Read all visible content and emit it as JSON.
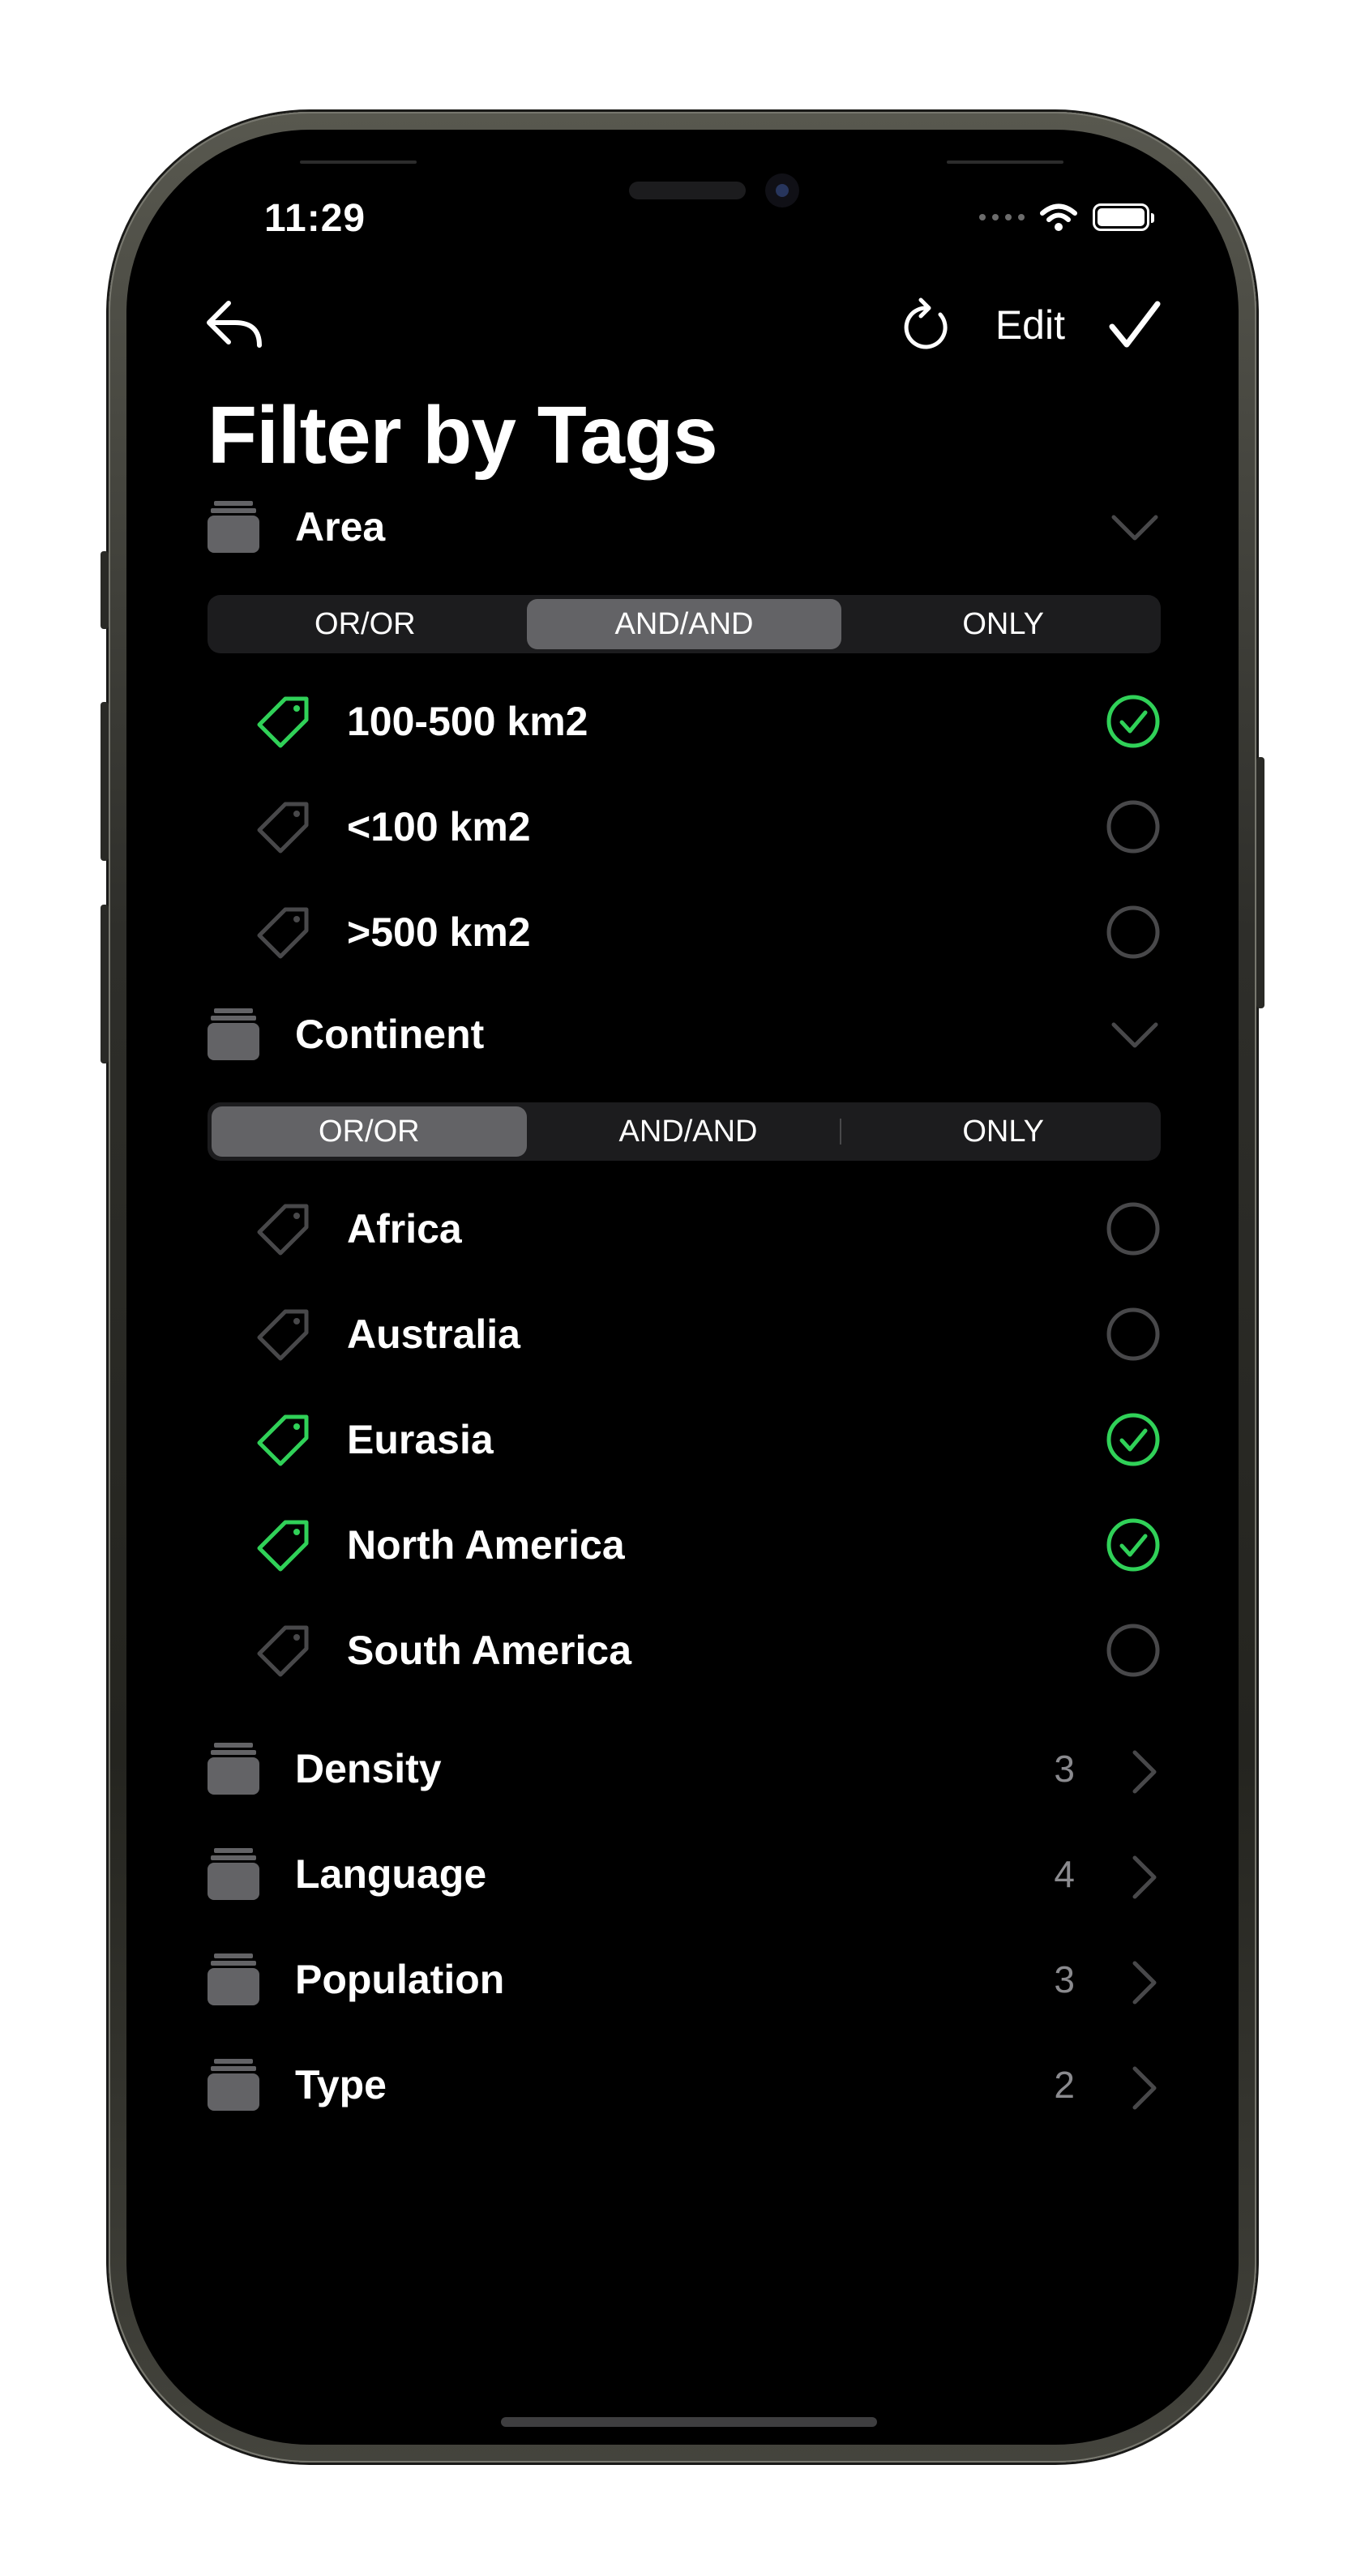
{
  "status_bar": {
    "time": "11:29"
  },
  "nav": {
    "edit_label": "Edit"
  },
  "page": {
    "title": "Filter by Tags"
  },
  "colors": {
    "accent": "#30d158",
    "inactive": "#48484a",
    "folder": "#636366"
  },
  "segmented": {
    "options": [
      "OR/OR",
      "AND/AND",
      "ONLY"
    ]
  },
  "groups": [
    {
      "label": "Area",
      "mode": "AND/AND",
      "tags": [
        {
          "label": "100-500 km2",
          "selected": true
        },
        {
          "label": "<100 km2",
          "selected": false
        },
        {
          "label": ">500 km2",
          "selected": false
        }
      ]
    },
    {
      "label": "Continent",
      "mode": "OR/OR",
      "tags": [
        {
          "label": "Africa",
          "selected": false
        },
        {
          "label": "Australia",
          "selected": false
        },
        {
          "label": "Eurasia",
          "selected": true
        },
        {
          "label": "North America",
          "selected": true
        },
        {
          "label": "South America",
          "selected": false
        }
      ]
    }
  ],
  "collapsed_groups": [
    {
      "label": "Density",
      "count": "3"
    },
    {
      "label": "Language",
      "count": "4"
    },
    {
      "label": "Population",
      "count": "3"
    },
    {
      "label": "Type",
      "count": "2"
    }
  ]
}
